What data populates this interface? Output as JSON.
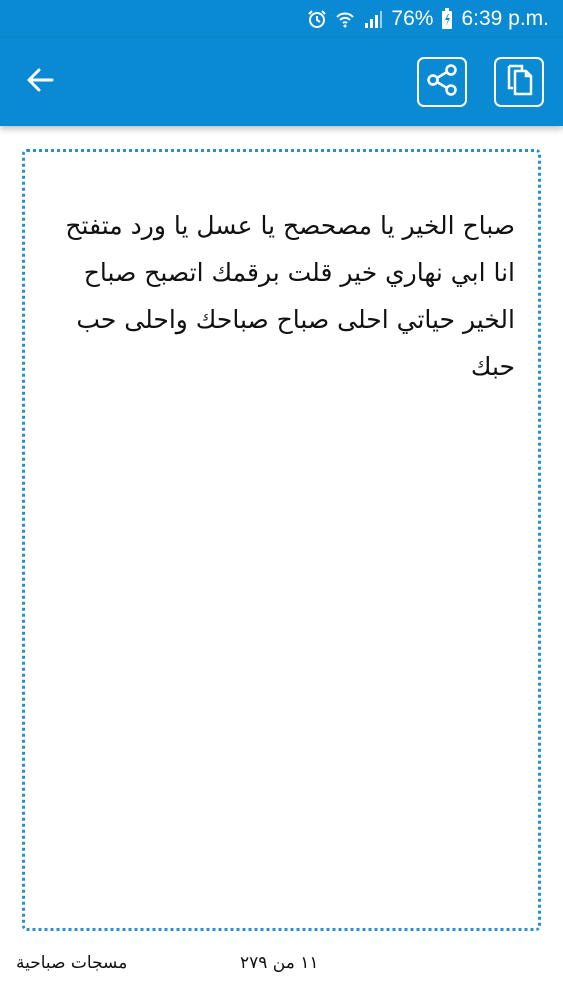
{
  "status_bar": {
    "battery": "76%",
    "time": "6:39 p.m.",
    "icons": [
      "alarm-icon",
      "wifi-icon",
      "signal-icon",
      "battery-icon"
    ]
  },
  "app_bar": {
    "back_icon": "arrow-left-icon",
    "share_icon": "share-icon",
    "copy_icon": "copy-icon",
    "color": "#0a8ad2"
  },
  "message": {
    "text": "صباح الخير يا مصحصح يا عسل يا ورد متفتح انا ابي نهاري خير قلت برقمك اتصبح صباح الخير حياتي احلى صباح صباحك واحلى حب حبك"
  },
  "footer": {
    "category": "مسجات صباحية",
    "counter": "١١ من ٢٧٩"
  }
}
